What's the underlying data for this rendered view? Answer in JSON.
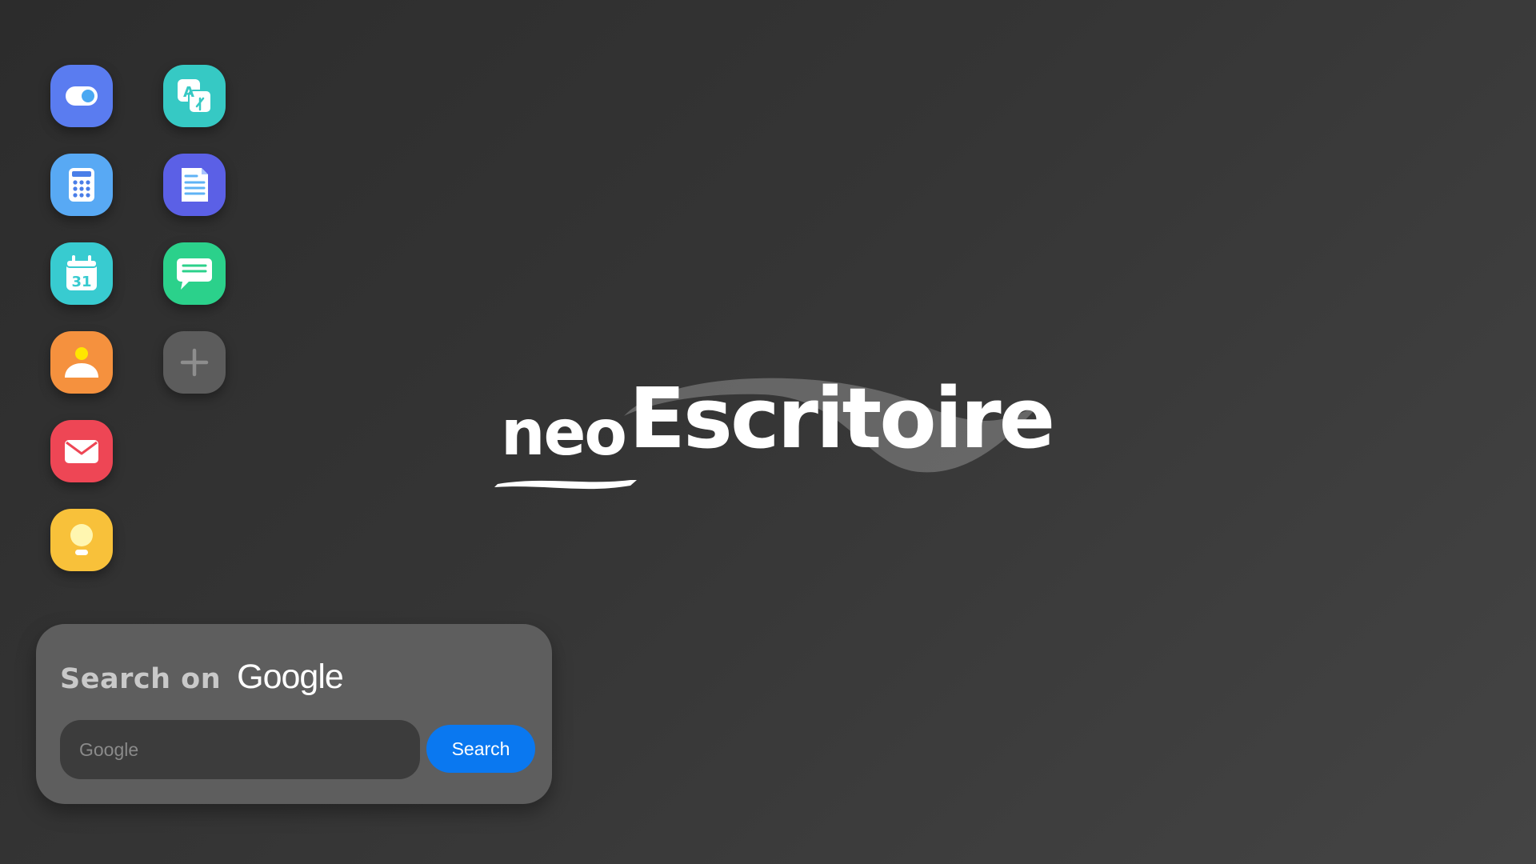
{
  "apps": [
    {
      "name": "toggle-settings",
      "icon": "toggle-icon",
      "color": "#5a7cf0"
    },
    {
      "name": "translate",
      "icon": "translate-icon",
      "color": "#36c9c4"
    },
    {
      "name": "calculator",
      "icon": "calculator-icon",
      "color": "#58a9f4"
    },
    {
      "name": "documents",
      "icon": "document-icon",
      "color": "#5b60e6"
    },
    {
      "name": "calendar",
      "icon": "calendar-icon",
      "color": "#38cbd0",
      "day": "31"
    },
    {
      "name": "messages",
      "icon": "chat-icon",
      "color": "#2bd18b"
    },
    {
      "name": "contacts",
      "icon": "person-icon",
      "color": "#f5913e"
    },
    {
      "name": "add-app",
      "icon": "plus-icon",
      "color": "#5c5c5c"
    },
    {
      "name": "mail",
      "icon": "mail-icon",
      "color": "#ee4655"
    },
    {
      "name": "ideas",
      "icon": "lightbulb-icon",
      "color": "#f8c13a"
    }
  ],
  "logo": {
    "prefix": "neo",
    "name": "Escritoire"
  },
  "search": {
    "label": "Search on",
    "provider": "Google",
    "placeholder": "Google",
    "value": "",
    "button_label": "Search",
    "button_color": "#0a78f0"
  }
}
